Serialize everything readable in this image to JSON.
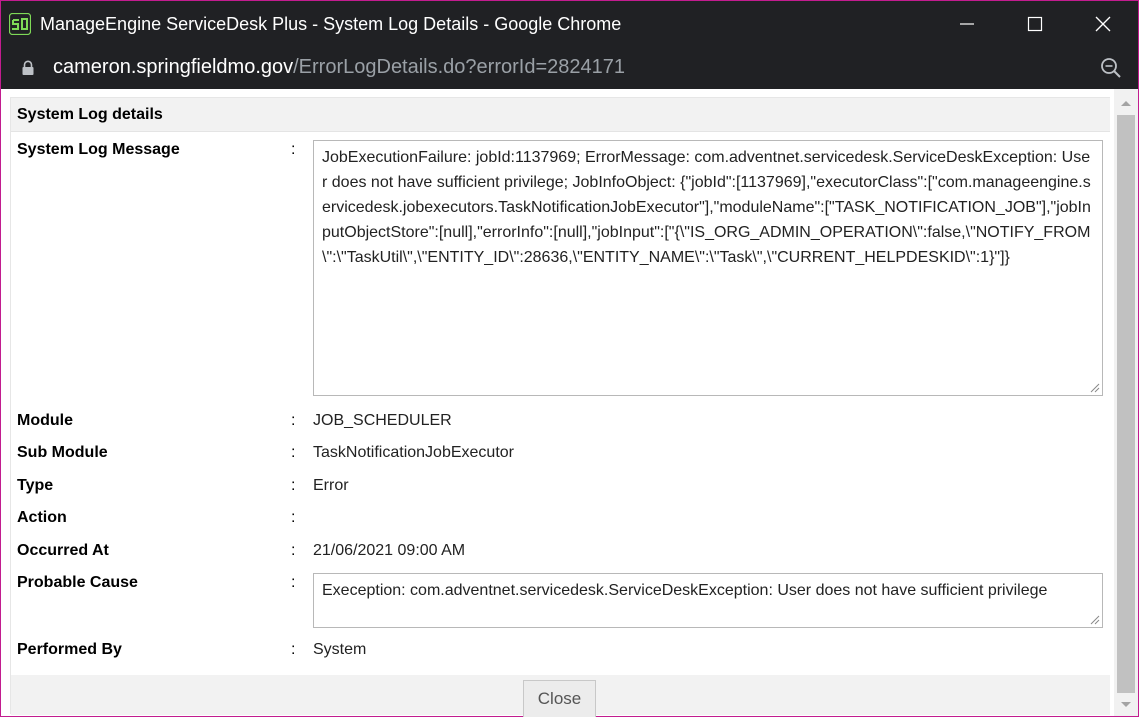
{
  "window": {
    "title": "ManageEngine ServiceDesk Plus - System Log Details - Google Chrome",
    "url_host": "cameron.springfieldmo.gov",
    "url_path": "/ErrorLogDetails.do?errorId=2824171",
    "accent_color": "#c21c8f",
    "titlebar_color": "#202124",
    "icons": [
      "app-icon",
      "minimize-icon",
      "maximize-icon",
      "close-icon",
      "lock-icon",
      "zoom-icon"
    ]
  },
  "panel": {
    "title": "System Log details"
  },
  "fields": {
    "message": {
      "label": "System Log Message",
      "value": "JobExecutionFailure: jobId:1137969; ErrorMessage: com.adventnet.servicedesk.ServiceDeskException: User does not have sufficient privilege; JobInfoObject: {\"jobId\":[1137969],\"executorClass\":[\"com.manageengine.servicedesk.jobexecutors.TaskNotificationJobExecutor\"],\"moduleName\":[\"TASK_NOTIFICATION_JOB\"],\"jobInputObjectStore\":[null],\"errorInfo\":[null],\"jobInput\":[\"{\\\"IS_ORG_ADMIN_OPERATION\\\":false,\\\"NOTIFY_FROM\\\":\\\"TaskUtil\\\",\\\"ENTITY_ID\\\":28636,\\\"ENTITY_NAME\\\":\\\"Task\\\",\\\"CURRENT_HELPDESKID\\\":1}\"]}"
    },
    "module": {
      "label": "Module",
      "value": "JOB_SCHEDULER"
    },
    "sub_module": {
      "label": "Sub Module",
      "value": "TaskNotificationJobExecutor"
    },
    "type": {
      "label": "Type",
      "value": "Error"
    },
    "action": {
      "label": "Action",
      "value": ""
    },
    "occurred_at": {
      "label": "Occurred At",
      "value": "21/06/2021 09:00 AM"
    },
    "probable_cause": {
      "label": "Probable Cause",
      "value": "Exeception: com.adventnet.servicedesk.ServiceDeskException: User does not have sufficient privilege"
    },
    "performed_by": {
      "label": "Performed By",
      "value": "System"
    }
  },
  "separator": ":",
  "footer": {
    "close_label": "Close"
  }
}
